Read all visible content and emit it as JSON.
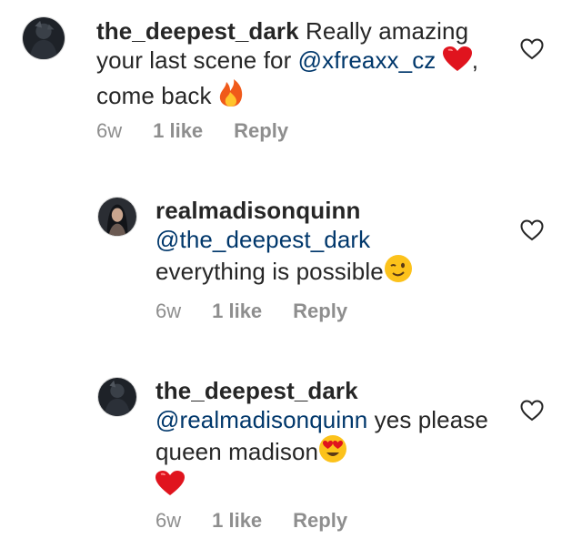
{
  "comments": [
    {
      "username": "the_deepest_dark",
      "text_before": " Really amazing your last scene for ",
      "mention": "@xfreaxx_cz",
      "text_after": ", come back",
      "time": "6w",
      "likes": "1 like",
      "reply": "Reply",
      "emojis": [
        "red-heart",
        "fire"
      ]
    },
    {
      "username": "realmadisonquinn",
      "mention": "@the_deepest_dark",
      "text_after": "everything is possible",
      "time": "6w",
      "likes": "1 like",
      "reply": "Reply",
      "emojis": [
        "winking-face"
      ]
    },
    {
      "username": "the_deepest_dark",
      "mention": "@realmadisonquinn",
      "text_after": " yes please queen madison",
      "time": "6w",
      "likes": "1 like",
      "reply": "Reply",
      "emojis": [
        "heart-eyes-face",
        "red-heart"
      ]
    }
  ],
  "colors": {
    "mention": "#00376b",
    "meta": "#8e8e8e",
    "text": "#262626"
  },
  "icons": [
    "like-heart-icon",
    "avatar"
  ]
}
